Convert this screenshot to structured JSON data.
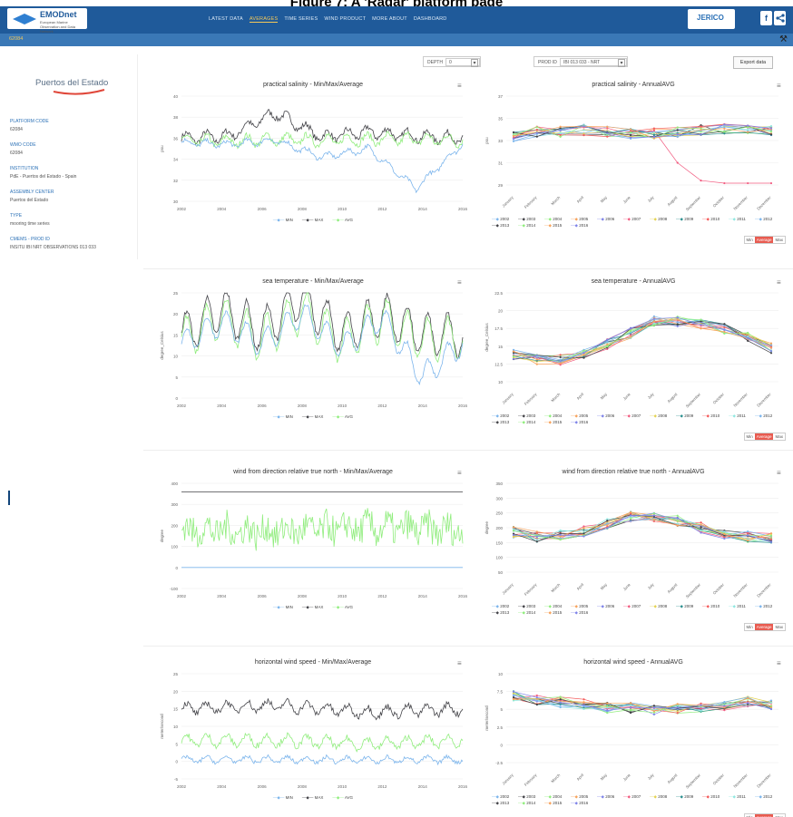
{
  "caption": "Figure 7: A 'Radar' platform page",
  "header": {
    "logo_text": "EMODnet",
    "logo_sub": "European Marine Observation and Data Network",
    "nav": [
      {
        "label": "LATEST DATA",
        "active": false
      },
      {
        "label": "AVERAGES",
        "active": true
      },
      {
        "label": "TIME SERIES",
        "active": false
      },
      {
        "label": "WIND PRODUCT",
        "active": false
      },
      {
        "label": "MORE ABOUT",
        "active": false
      },
      {
        "label": "DASHBOARD",
        "active": false
      }
    ],
    "partner_logo": "JERICO",
    "facebook": "f",
    "share_icon": "share-icon",
    "platform_id": "62084",
    "settings_icon": "settings-icon"
  },
  "sidebar": {
    "institution_logo": "Puertos del Estado",
    "fields": [
      {
        "label": "PLATFORM CODE",
        "value": "62084"
      },
      {
        "label": "WMO CODE",
        "value": "62084"
      },
      {
        "label": "INSTITUTION",
        "value": "PdE - Puertos del Estado - Spain"
      },
      {
        "label": "ASSEMBLY CENTER",
        "value": "Puertos del Estado"
      },
      {
        "label": "TYPE",
        "value": "mooring time series"
      },
      {
        "label": "CMEMS - PROD ID",
        "value": "INSITU IBI NRT OBSERVATIONS 013 033"
      }
    ]
  },
  "controls": {
    "depth_label": "DEPTH",
    "depth_value": "0",
    "prod_label": "PROD ID",
    "prod_value": "IBI 013 033 - NRT",
    "export_label": "Export data"
  },
  "toggle_labels": [
    "Min",
    "Average",
    "Max"
  ],
  "colors": {
    "min": "#7cb5ec",
    "max": "#434348",
    "avg": "#90ed7d",
    "accent": "#f3c85a",
    "nav": "#1f5a9a"
  },
  "years": [
    "2002",
    "2003",
    "2004",
    "2005",
    "2006",
    "2007",
    "2008",
    "2009",
    "2010",
    "2011",
    "2012",
    "2013",
    "2014",
    "2015",
    "2016"
  ],
  "year_colors": [
    "#7cb5ec",
    "#434348",
    "#90ed7d",
    "#f7a35c",
    "#8085e9",
    "#f15c80",
    "#e4d354",
    "#2b908f",
    "#f45b5b",
    "#91e8e1",
    "#7cb5ec",
    "#434348",
    "#90ed7d",
    "#f7a35c",
    "#8085e9"
  ],
  "months": [
    "January",
    "February",
    "March",
    "April",
    "May",
    "June",
    "July",
    "August",
    "September",
    "October",
    "November",
    "December"
  ],
  "time_x_ticks": [
    "2002",
    "2004",
    "2006",
    "2008",
    "2010",
    "2012",
    "2014",
    "2016"
  ],
  "left_legend": [
    "MIN",
    "MAX",
    "AVG"
  ],
  "chart_data": [
    {
      "type": "line",
      "title": "practical salinity - Min/Max/Average",
      "ylabel": "psu",
      "yticks": [
        "30",
        "32",
        "34",
        "36",
        "38",
        "40"
      ],
      "ylim": [
        30,
        40
      ],
      "xlim": [
        2002,
        2016
      ],
      "series": [
        {
          "name": "MIN",
          "values": [
            35.6,
            35.4,
            35.8,
            34.2,
            35.0,
            31.2,
            35.5
          ]
        },
        {
          "name": "MAX",
          "values": [
            36.0,
            36.2,
            38.4,
            36.1,
            36.6,
            36.2,
            36.0
          ]
        },
        {
          "name": "AVG",
          "values": [
            35.8,
            35.7,
            35.9,
            35.8,
            35.9,
            35.9,
            35.8
          ]
        }
      ]
    },
    {
      "type": "line",
      "title": "practical salinity - AnnualAVG",
      "ylabel": "psu",
      "yticks": [
        "29",
        "31",
        "33",
        "35",
        "37"
      ],
      "ylim": [
        29,
        37
      ],
      "xlim_categories": "months",
      "series_by_year": true
    },
    {
      "type": "line",
      "title": "sea temperature - Min/Max/Average",
      "ylabel": "degree_Celsius",
      "yticks": [
        "0",
        "5",
        "10",
        "15",
        "20",
        "25"
      ],
      "ylim": [
        0,
        25
      ],
      "series": [
        {
          "name": "MIN",
          "values": [
            13,
            18,
            13,
            20,
            12,
            19,
            5,
            13
          ]
        },
        {
          "name": "MAX",
          "values": [
            15,
            21,
            16,
            24,
            15,
            20,
            15,
            15
          ]
        },
        {
          "name": "AVG",
          "values": [
            14,
            19,
            14,
            21,
            13,
            19,
            14,
            14
          ]
        }
      ]
    },
    {
      "type": "line",
      "title": "sea temperature - AnnualAVG",
      "ylabel": "degree_Celsius",
      "yticks": [
        "10",
        "12.5",
        "15",
        "17.5",
        "20",
        "22.5"
      ],
      "ylim": [
        10,
        22.5
      ],
      "series_by_year": true
    },
    {
      "type": "line",
      "title": "wind from direction relative true north - Min/Max/Average",
      "ylabel": "degree",
      "yticks": [
        "-100",
        "0",
        "100",
        "200",
        "300",
        "400"
      ],
      "ylim": [
        -100,
        400
      ],
      "series": [
        {
          "name": "MIN",
          "values": [
            0,
            0,
            0,
            0
          ]
        },
        {
          "name": "MAX",
          "values": [
            359,
            359,
            359,
            359
          ]
        },
        {
          "name": "AVG",
          "values": [
            180,
            170,
            190,
            175
          ]
        }
      ]
    },
    {
      "type": "line",
      "title": "wind from direction relative true north - AnnualAVG",
      "ylabel": "degree",
      "yticks": [
        "50",
        "100",
        "150",
        "200",
        "250",
        "300",
        "350"
      ],
      "ylim": [
        50,
        350
      ],
      "series_by_year": true
    },
    {
      "type": "line",
      "title": "horizontal wind speed - Min/Max/Average",
      "ylabel": "meter/second",
      "yticks": [
        "-5",
        "0",
        "5",
        "10",
        "15",
        "20",
        "25"
      ],
      "ylim": [
        -5,
        25
      ],
      "series": [
        {
          "name": "MIN",
          "values": [
            0.5,
            0.5,
            0.4,
            0.5
          ]
        },
        {
          "name": "MAX",
          "values": [
            15,
            16,
            14,
            15
          ]
        },
        {
          "name": "AVG",
          "values": [
            6,
            6,
            5,
            6
          ]
        }
      ]
    },
    {
      "type": "line",
      "title": "horizontal wind speed - AnnualAVG",
      "ylabel": "meter/second",
      "yticks": [
        "-2.5",
        "0",
        "2.5",
        "5",
        "7.5",
        "10"
      ],
      "ylim": [
        -2.5,
        10
      ],
      "series_by_year": true
    }
  ]
}
